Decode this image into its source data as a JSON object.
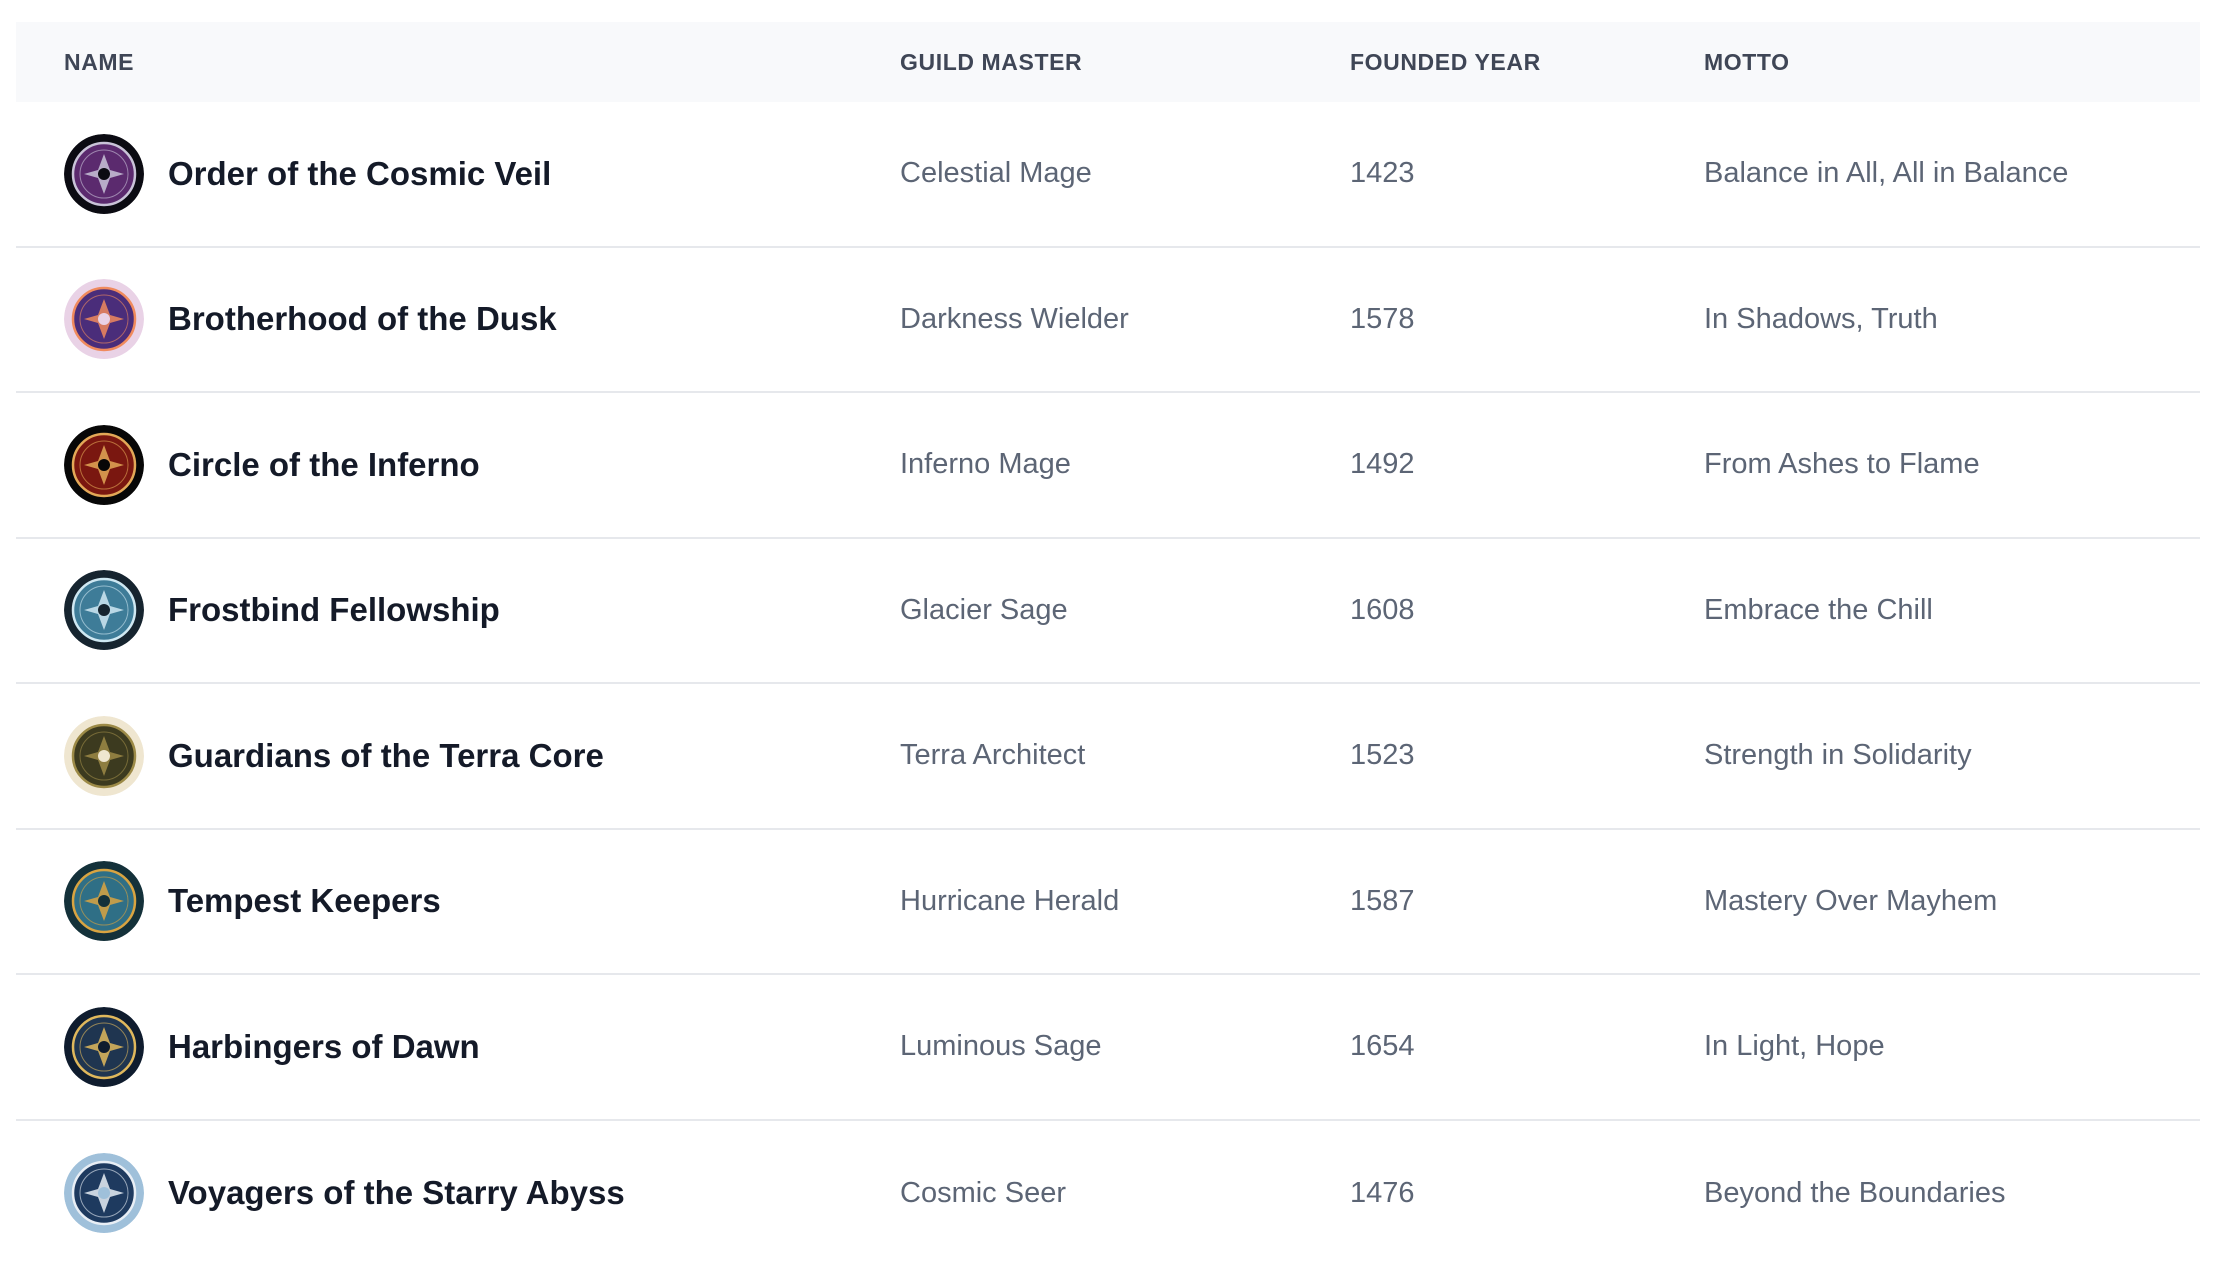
{
  "table": {
    "headers": {
      "name": "NAME",
      "master": "GUILD MASTER",
      "year": "FOUNDED YEAR",
      "motto": "MOTTO"
    },
    "rows": [
      {
        "name": "Order of the Cosmic Veil",
        "master": "Celestial Mage",
        "year": "1423",
        "motto": "Balance in All, All in Balance",
        "avatar_icon": "cosmic-veil-emblem-icon",
        "avatar_colors": [
          "#0b0b12",
          "#5b2a6e",
          "#c9c3d8"
        ]
      },
      {
        "name": "Brotherhood of the Dusk",
        "master": "Darkness Wielder",
        "year": "1578",
        "motto": "In Shadows, Truth",
        "avatar_icon": "dusk-emblem-icon",
        "avatar_colors": [
          "#e9d2e6",
          "#4a2d7a",
          "#f08a5d"
        ]
      },
      {
        "name": "Circle of the Inferno",
        "master": "Inferno Mage",
        "year": "1492",
        "motto": "From Ashes to Flame",
        "avatar_icon": "inferno-emblem-icon",
        "avatar_colors": [
          "#070707",
          "#7a1710",
          "#e3a857"
        ]
      },
      {
        "name": "Frostbind Fellowship",
        "master": "Glacier Sage",
        "year": "1608",
        "motto": "Embrace the Chill",
        "avatar_icon": "frost-emblem-icon",
        "avatar_colors": [
          "#16242f",
          "#3e7c98",
          "#cfe8f2"
        ]
      },
      {
        "name": "Guardians of the Terra Core",
        "master": "Terra Architect",
        "year": "1523",
        "motto": "Strength in Solidarity",
        "avatar_icon": "terra-emblem-icon",
        "avatar_colors": [
          "#efe6d0",
          "#3c3a1f",
          "#9c8a47"
        ]
      },
      {
        "name": "Tempest Keepers",
        "master": "Hurricane Herald",
        "year": "1587",
        "motto": "Mastery Over Mayhem",
        "avatar_icon": "tempest-emblem-icon",
        "avatar_colors": [
          "#14313a",
          "#2f6f86",
          "#d9a441"
        ]
      },
      {
        "name": "Harbingers of Dawn",
        "master": "Luminous Sage",
        "year": "1654",
        "motto": "In Light, Hope",
        "avatar_icon": "dawn-emblem-icon",
        "avatar_colors": [
          "#0f1c2e",
          "#1f3550",
          "#e0b85c"
        ]
      },
      {
        "name": "Voyagers of the Starry Abyss",
        "master": "Cosmic Seer",
        "year": "1476",
        "motto": "Beyond the Boundaries",
        "avatar_icon": "starry-abyss-emblem-icon",
        "avatar_colors": [
          "#9fc0da",
          "#1e3a5f",
          "#e8eef5"
        ]
      }
    ]
  }
}
